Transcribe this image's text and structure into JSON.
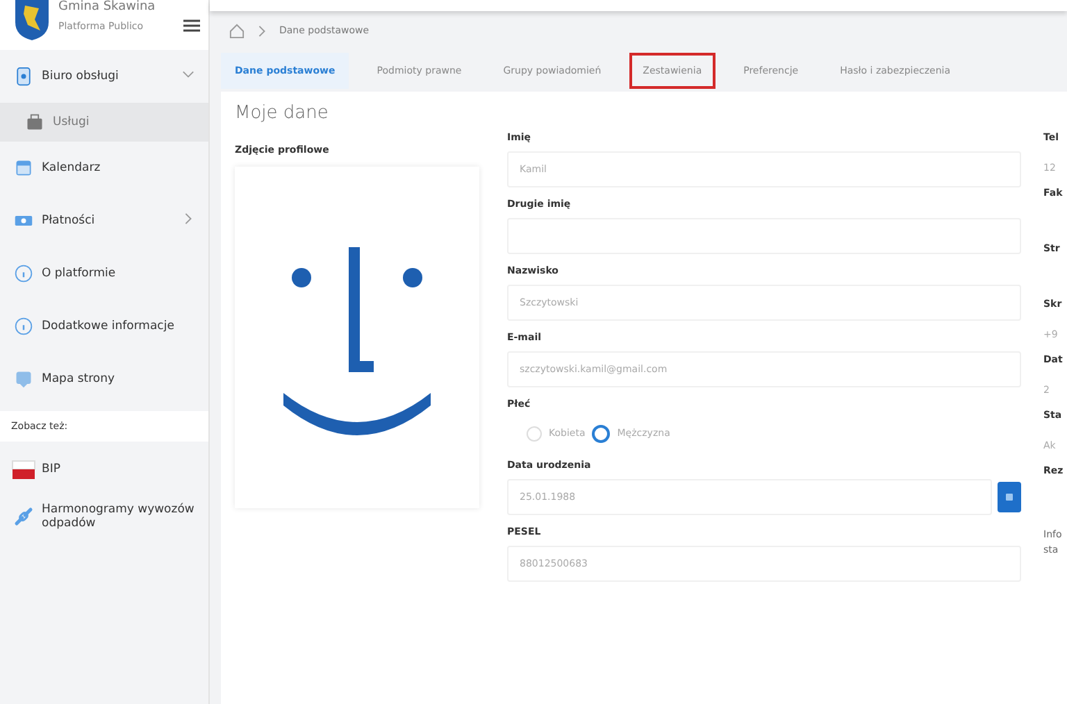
{
  "header": {
    "org": "Gmina Skawina",
    "platform": "Platforma Publico"
  },
  "sidebar": {
    "items": [
      {
        "label": "Biuro obsługi",
        "expanded": true,
        "children": [
          {
            "label": "Usługi",
            "selected": true
          }
        ]
      },
      {
        "label": "Kalendarz"
      },
      {
        "label": "Płatności",
        "expanded": false
      },
      {
        "label": "O platformie"
      },
      {
        "label": "Dodatkowe informacje"
      },
      {
        "label": "Mapa strony"
      }
    ],
    "see_also_title": "Zobacz też:",
    "links": [
      {
        "label": "BIP"
      },
      {
        "label": "Harmonogramy wywozów odpadów"
      }
    ]
  },
  "breadcrumb": [
    "Dane podstawowe"
  ],
  "tabs": [
    {
      "label": "Dane podstawowe",
      "selected": true,
      "highlighted": false
    },
    {
      "label": "Podmioty prawne",
      "selected": false,
      "highlighted": false
    },
    {
      "label": "Grupy powiadomień",
      "selected": false,
      "highlighted": false
    },
    {
      "label": "Zestawienia",
      "selected": false,
      "highlighted": true
    },
    {
      "label": "Preferencje",
      "selected": false,
      "highlighted": false
    },
    {
      "label": "Hasło i zabezpieczenia",
      "selected": false,
      "highlighted": false
    }
  ],
  "page_title": "Moje dane",
  "profile_label": "Zdjęcie profilowe",
  "fields": [
    {
      "kind": "text",
      "label": "Imię",
      "value": "Kamil"
    },
    {
      "kind": "text",
      "label": "Drugie imię"
    },
    {
      "kind": "text",
      "label": "Nazwisko",
      "value": "Szczytowski"
    },
    {
      "kind": "text",
      "label": "E-mail",
      "value": "szczytowski.kamil@gmail.com"
    },
    {
      "kind": "radio",
      "label": "Płeć",
      "options": [
        {
          "label": "Kobieta",
          "selected": false
        },
        {
          "label": "Mężczyzna",
          "selected": true
        }
      ]
    },
    {
      "kind": "date",
      "label": "Data urodzenia",
      "value": "25.01.1988"
    },
    {
      "kind": "text",
      "label": "PESEL",
      "value": "88012500683"
    }
  ],
  "right_column": [
    {
      "label": "Tel",
      "value": "12"
    },
    {
      "label": "Fak"
    },
    {
      "label": "Str"
    },
    {
      "label": "Skr",
      "value": "+9"
    },
    {
      "label": "Dat",
      "value": "2"
    },
    {
      "label": "Sta",
      "value": "Ak"
    },
    {
      "label": "Rez"
    }
  ],
  "right_note": [
    "Info",
    "sta"
  ]
}
